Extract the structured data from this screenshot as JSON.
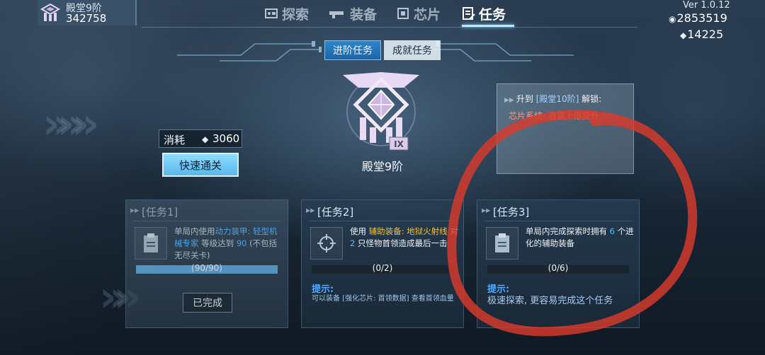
{
  "player": {
    "rank": "殿堂9阶",
    "score": "342758"
  },
  "top_tabs": [
    {
      "label": "探索",
      "icon": "explore-icon",
      "active": false
    },
    {
      "label": "装备",
      "icon": "gun-icon",
      "active": false
    },
    {
      "label": "芯片",
      "icon": "chip-icon",
      "active": false
    },
    {
      "label": "任务",
      "icon": "task-icon",
      "active": true
    }
  ],
  "version": "Ver 1.0.12",
  "currency": {
    "coins": "2853519",
    "crystals": "14225"
  },
  "sub_tabs": [
    {
      "label": "进阶任务",
      "active": true
    },
    {
      "label": "成就任务",
      "active": false
    }
  ],
  "rank_emblem": {
    "numeral": "IX",
    "name": "殿堂9阶"
  },
  "unlock": {
    "prefix": "升到",
    "target": "[殿堂10阶]",
    "suffix": "解锁:",
    "desc": "芯片系统: 容量上限提升"
  },
  "quick_clear": {
    "cost_label": "消耗",
    "cost_value": "3060",
    "button_label": "快速通关"
  },
  "quests": [
    {
      "title": "[任务1]",
      "desc_parts": [
        "单局内使用",
        "动力装甲: 轻型机械专家",
        "等级达到",
        "90",
        "(不包括无尽关卡)"
      ],
      "progress_text": "(90/90)",
      "progress": 1.0,
      "completed": true,
      "button_label": "已完成"
    },
    {
      "title": "[任务2]",
      "desc_parts": [
        "使用",
        "辅助装备: 地狱火射线",
        "对",
        "2",
        "只怪物首领造成最后一击"
      ],
      "progress_text": "(0/2)",
      "progress": 0,
      "completed": false,
      "hint_label": "提示:",
      "hint_text": "可以装备 [强化芯片: 首领数据] 查看首领血量"
    },
    {
      "title": "[任务3]",
      "desc_parts": [
        "单局内完成探索时拥有",
        "6",
        "个进化的辅助装备"
      ],
      "progress_text": "(0/6)",
      "progress": 0,
      "completed": false,
      "hint_label": "提示:",
      "hint_text": "极速探索, 更容易完成这个任务"
    }
  ],
  "colors": {
    "accent_blue": "#58b8ff",
    "highlight_yellow": "#f0c040",
    "annotation_red": "#d93b2c",
    "unlock_desc": "#ff9a84"
  }
}
